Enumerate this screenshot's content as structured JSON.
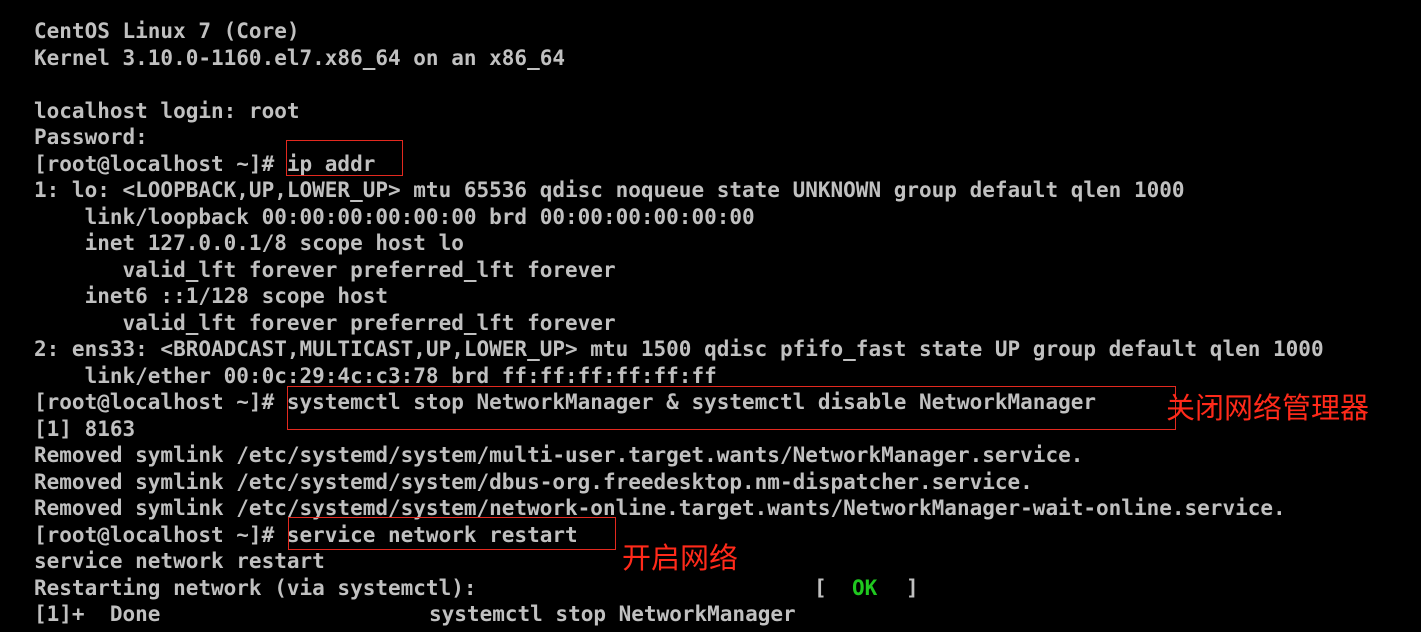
{
  "terminal": {
    "lines": [
      "CentOS Linux 7 (Core)",
      "Kernel 3.10.0-1160.el7.x86_64 on an x86_64",
      "",
      "localhost login: root",
      "Password:",
      "[root@localhost ~]# ip addr",
      "1: lo: <LOOPBACK,UP,LOWER_UP> mtu 65536 qdisc noqueue state UNKNOWN group default qlen 1000",
      "    link/loopback 00:00:00:00:00:00 brd 00:00:00:00:00:00",
      "    inet 127.0.0.1/8 scope host lo",
      "       valid_lft forever preferred_lft forever",
      "    inet6 ::1/128 scope host",
      "       valid_lft forever preferred_lft forever",
      "2: ens33: <BROADCAST,MULTICAST,UP,LOWER_UP> mtu 1500 qdisc pfifo_fast state UP group default qlen 1000",
      "    link/ether 00:0c:29:4c:c3:78 brd ff:ff:ff:ff:ff:ff",
      "[root@localhost ~]# systemctl stop NetworkManager & systemctl disable NetworkManager",
      "[1] 8163",
      "Removed symlink /etc/systemd/system/multi-user.target.wants/NetworkManager.service.",
      "Removed symlink /etc/systemd/system/dbus-org.freedesktop.nm-dispatcher.service.",
      "Removed symlink /etc/systemd/system/network-online.target.wants/NetworkManager-wait-online.service.",
      "[root@localhost ~]# service network restart",
      "service network restart"
    ],
    "restart_status": {
      "label": "Restarting network (via systemctl):",
      "bracket_open": "[",
      "ok": "OK",
      "bracket_close": "]"
    },
    "done_line": {
      "job": "[1]+  Done",
      "command": "systemctl stop NetworkManager"
    }
  },
  "annotations": {
    "close_network_manager": "关闭网络管理器",
    "open_network": "开启网络"
  },
  "colors": {
    "background": "#000000",
    "text": "#c0c0c0",
    "ok": "#1fc81f",
    "annotation_red": "#ff2a1a",
    "box_red": "#e3291f"
  }
}
